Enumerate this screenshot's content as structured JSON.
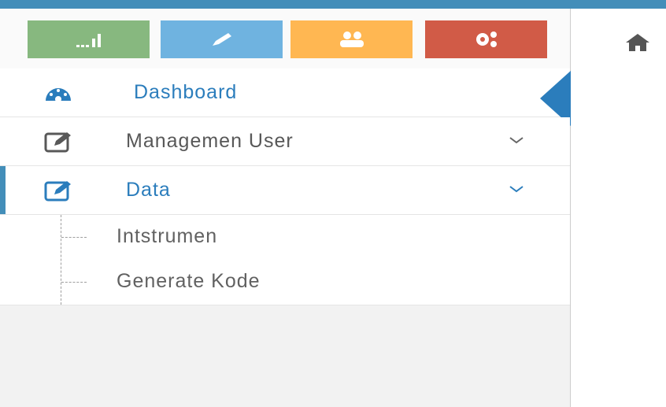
{
  "colors": {
    "topbar": "#438eb9",
    "shortcut_success": "#87b87f",
    "shortcut_info": "#6fb3e0",
    "shortcut_warning": "#ffb752",
    "shortcut_danger": "#d15b47",
    "active_text": "#2b7dbc"
  },
  "shortcuts": [
    {
      "icon": "signal-icon"
    },
    {
      "icon": "pencil-icon"
    },
    {
      "icon": "users-icon"
    },
    {
      "icon": "cogs-icon"
    }
  ],
  "breadcrumb": {
    "home_icon": "home-icon"
  },
  "nav": {
    "dashboard": {
      "label": "Dashboard",
      "icon": "tachometer-icon"
    },
    "manage_user": {
      "label": "Managemen User",
      "icon": "pencil-square-icon"
    },
    "data": {
      "label": "Data",
      "icon": "pencil-square-icon",
      "children": [
        {
          "label": "Intstrumen"
        },
        {
          "label": "Generate Kode"
        }
      ]
    }
  }
}
